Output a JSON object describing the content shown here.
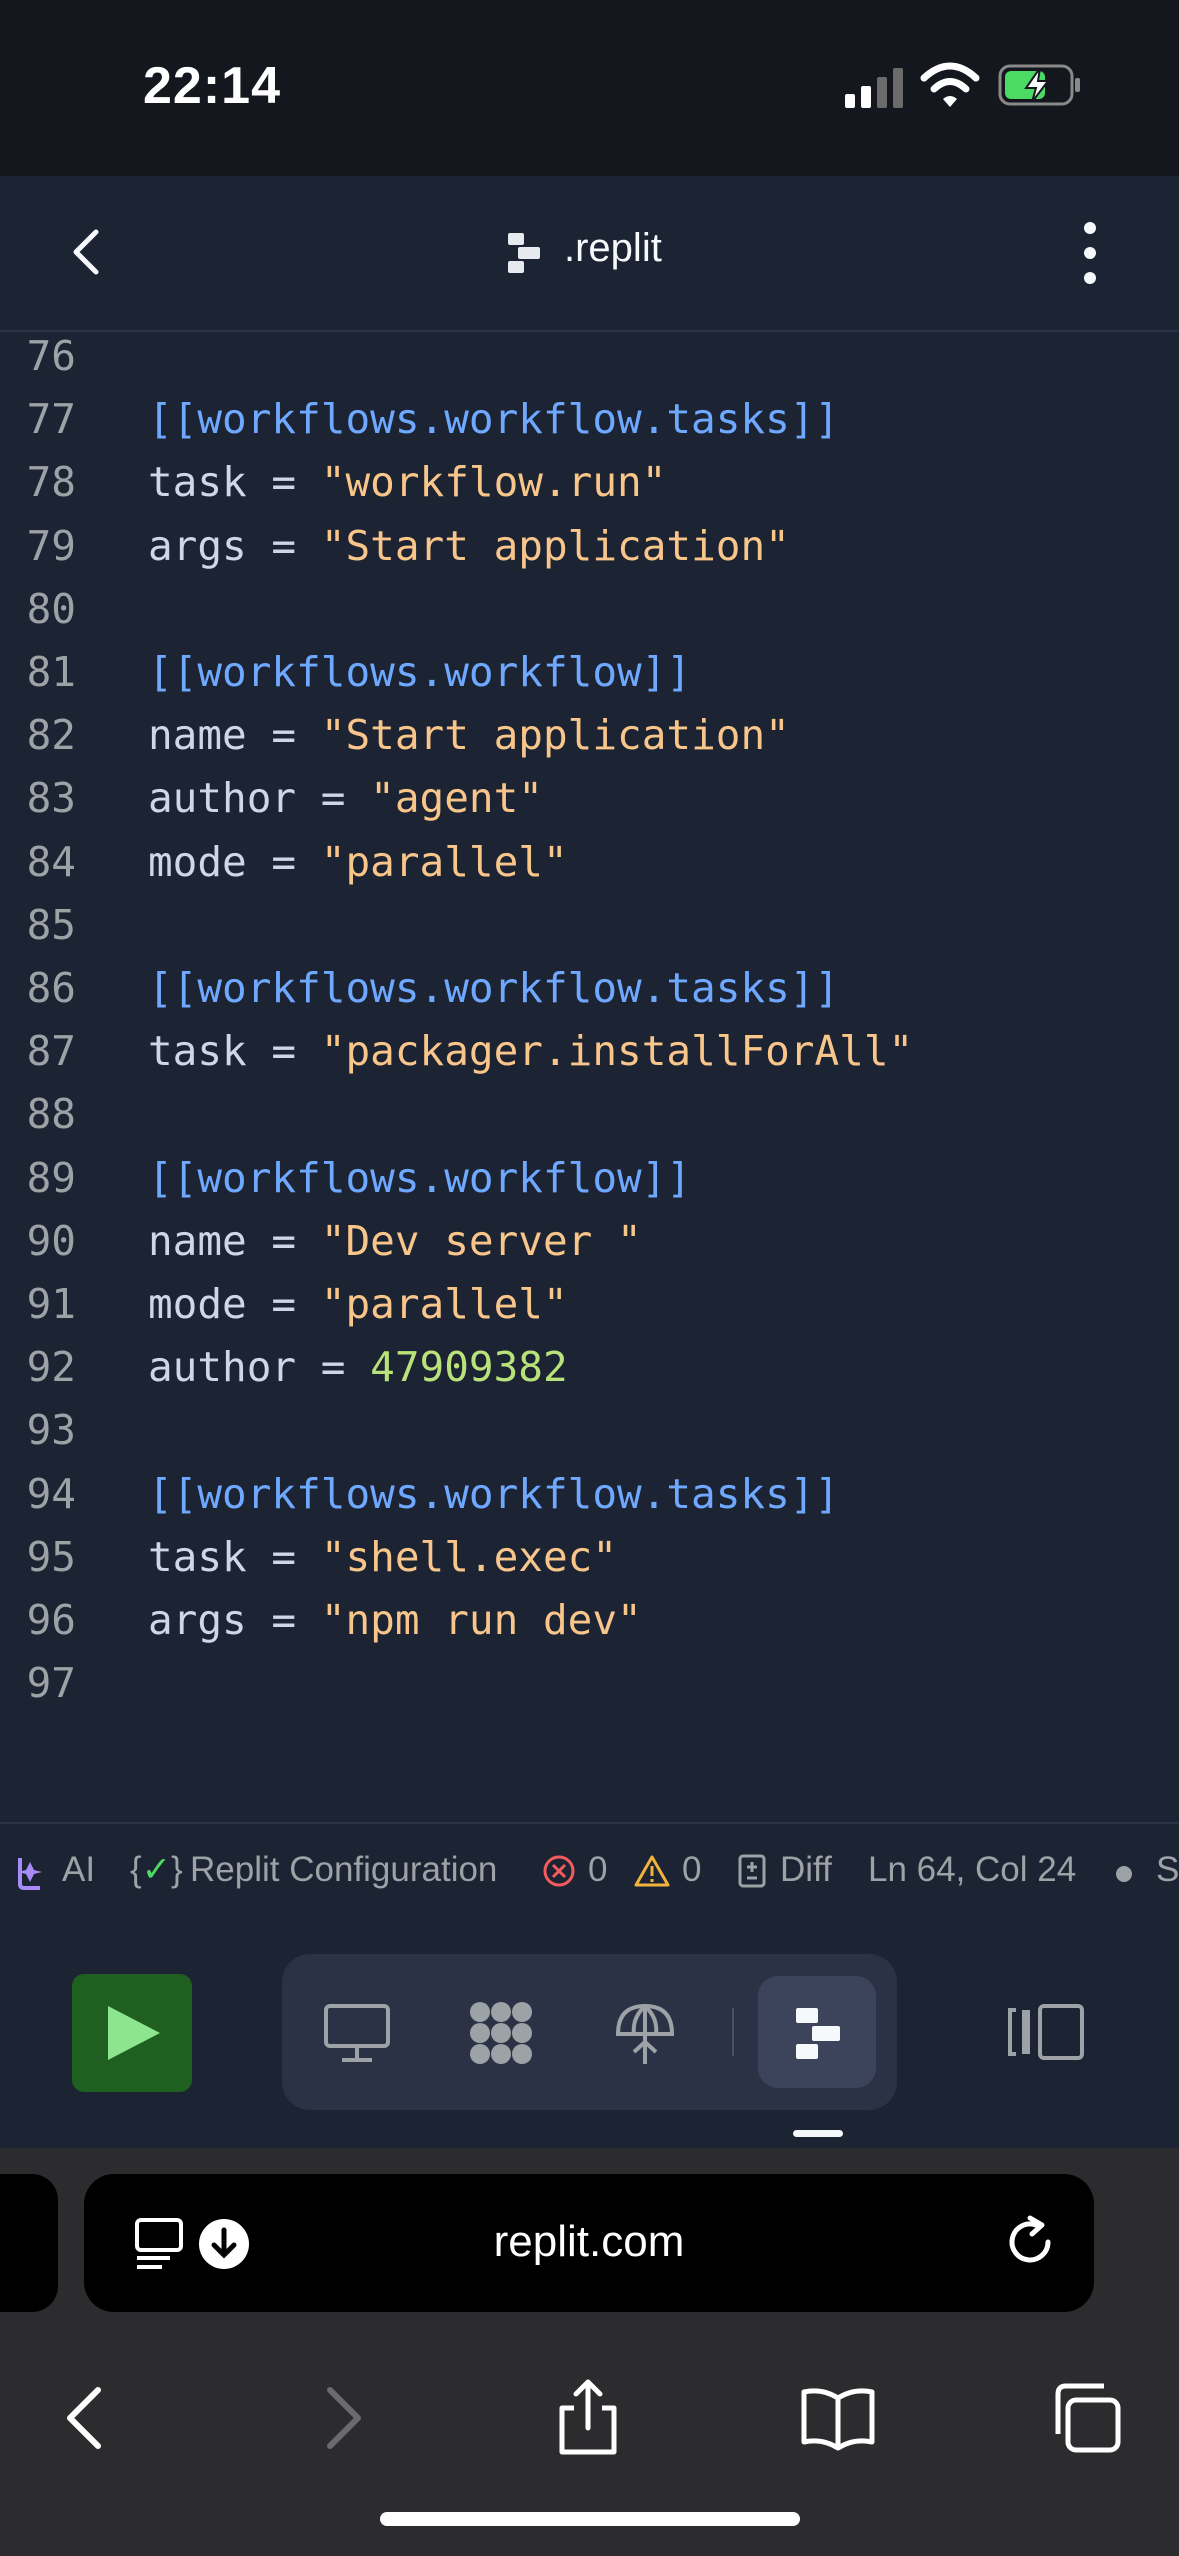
{
  "status_bar": {
    "time": "22:14"
  },
  "app_bar": {
    "filename": ".replit"
  },
  "editor": {
    "lines": [
      {
        "n": "76",
        "tokens": []
      },
      {
        "n": "77",
        "tokens": [
          {
            "t": "[[workflows.workflow.tasks]]",
            "c": "c-header"
          }
        ]
      },
      {
        "n": "78",
        "tokens": [
          {
            "t": "task",
            "c": "c-key"
          },
          {
            "t": " = ",
            "c": "c-eq"
          },
          {
            "t": "\"workflow.run\"",
            "c": "c-str"
          }
        ]
      },
      {
        "n": "79",
        "tokens": [
          {
            "t": "args",
            "c": "c-key"
          },
          {
            "t": " = ",
            "c": "c-eq"
          },
          {
            "t": "\"Start application\"",
            "c": "c-str"
          }
        ]
      },
      {
        "n": "80",
        "tokens": []
      },
      {
        "n": "81",
        "tokens": [
          {
            "t": "[[workflows.workflow]]",
            "c": "c-header"
          }
        ]
      },
      {
        "n": "82",
        "tokens": [
          {
            "t": "name",
            "c": "c-key"
          },
          {
            "t": " = ",
            "c": "c-eq"
          },
          {
            "t": "\"Start application\"",
            "c": "c-str"
          }
        ]
      },
      {
        "n": "83",
        "tokens": [
          {
            "t": "author",
            "c": "c-key"
          },
          {
            "t": " = ",
            "c": "c-eq"
          },
          {
            "t": "\"agent\"",
            "c": "c-str"
          }
        ]
      },
      {
        "n": "84",
        "tokens": [
          {
            "t": "mode",
            "c": "c-key"
          },
          {
            "t": " = ",
            "c": "c-eq"
          },
          {
            "t": "\"parallel\"",
            "c": "c-str"
          }
        ]
      },
      {
        "n": "85",
        "tokens": []
      },
      {
        "n": "86",
        "tokens": [
          {
            "t": "[[workflows.workflow.tasks]]",
            "c": "c-header"
          }
        ]
      },
      {
        "n": "87",
        "tokens": [
          {
            "t": "task",
            "c": "c-key"
          },
          {
            "t": " = ",
            "c": "c-eq"
          },
          {
            "t": "\"packager.installForAll\"",
            "c": "c-str"
          }
        ]
      },
      {
        "n": "88",
        "tokens": []
      },
      {
        "n": "89",
        "tokens": [
          {
            "t": "[[workflows.workflow]]",
            "c": "c-header"
          }
        ]
      },
      {
        "n": "90",
        "tokens": [
          {
            "t": "name",
            "c": "c-key"
          },
          {
            "t": " = ",
            "c": "c-eq"
          },
          {
            "t": "\"Dev server \"",
            "c": "c-str"
          }
        ]
      },
      {
        "n": "91",
        "tokens": [
          {
            "t": "mode",
            "c": "c-key"
          },
          {
            "t": " = ",
            "c": "c-eq"
          },
          {
            "t": "\"parallel\"",
            "c": "c-str"
          }
        ]
      },
      {
        "n": "92",
        "tokens": [
          {
            "t": "author",
            "c": "c-key"
          },
          {
            "t": " = ",
            "c": "c-eq"
          },
          {
            "t": "47909382",
            "c": "c-num"
          }
        ]
      },
      {
        "n": "93",
        "tokens": []
      },
      {
        "n": "94",
        "tokens": [
          {
            "t": "[[workflows.workflow.tasks]]",
            "c": "c-header"
          }
        ]
      },
      {
        "n": "95",
        "tokens": [
          {
            "t": "task",
            "c": "c-key"
          },
          {
            "t": " = ",
            "c": "c-eq"
          },
          {
            "t": "\"shell.exec\"",
            "c": "c-str"
          }
        ]
      },
      {
        "n": "96",
        "tokens": [
          {
            "t": "args",
            "c": "c-key"
          },
          {
            "t": " = ",
            "c": "c-eq"
          },
          {
            "t": "\"npm run dev\"",
            "c": "c-str"
          }
        ]
      },
      {
        "n": "97",
        "tokens": []
      }
    ]
  },
  "footer": {
    "ai_label": "AI",
    "language_label": "Replit Configuration",
    "errors": "0",
    "warnings": "0",
    "diff_label": "Diff",
    "cursor": "Ln 64, Col 24",
    "trailing": "S"
  },
  "browser": {
    "url": "replit.com"
  },
  "colors": {
    "run_button": "#1f5f1f",
    "accent_blue": "#6ea8ff",
    "string": "#f8c58a",
    "number": "#b9e27a"
  }
}
